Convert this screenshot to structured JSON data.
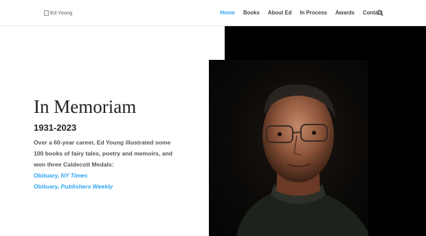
{
  "header": {
    "logo_alt": "Ed Young",
    "nav": [
      {
        "label": "Home",
        "active": true
      },
      {
        "label": "Books",
        "active": false
      },
      {
        "label": "About Ed",
        "active": false
      },
      {
        "label": "In Process",
        "active": false
      },
      {
        "label": "Awards",
        "active": false
      },
      {
        "label": "Contact",
        "active": false
      }
    ],
    "search_icon": "search-icon"
  },
  "main": {
    "title": "In Memoriam",
    "years": "1931-2023",
    "description": "Over a 60-year career, Ed Young illustrated some 100 books of fairy tales, poetry and memoirs, and won three Caldecott Medals:",
    "links": [
      {
        "prefix": "Obituary, ",
        "italic": "NY Times"
      },
      {
        "prefix": "Obituary, ",
        "italic": "Publishers Weekly"
      }
    ]
  },
  "colors": {
    "accent": "#2ea3f2",
    "text": "#222222",
    "dark_panel": "#000000"
  }
}
